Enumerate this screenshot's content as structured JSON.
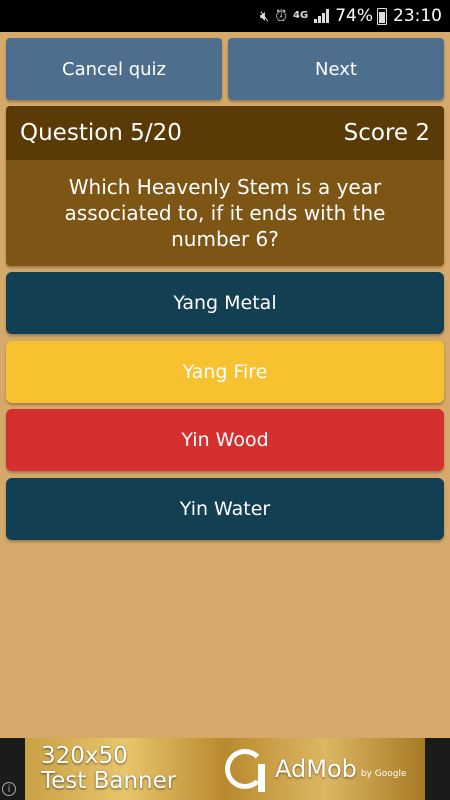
{
  "status_bar": {
    "battery_percent": "74%",
    "time": "23:10",
    "network": "4G"
  },
  "top_buttons": {
    "cancel_label": "Cancel quiz",
    "next_label": "Next"
  },
  "question": {
    "progress": "Question 5/20",
    "score": "Score 2",
    "text": "Which Heavenly Stem is a year associated to, if it ends with the number 6?"
  },
  "answers": [
    {
      "label": "Yang Metal",
      "state": "default",
      "color": "#123f52"
    },
    {
      "label": "Yang Fire",
      "state": "correct",
      "color": "#f7c130"
    },
    {
      "label": "Yin Wood",
      "state": "wrong",
      "color": "#d62f2f"
    },
    {
      "label": "Yin Water",
      "state": "default",
      "color": "#123f52"
    }
  ],
  "ad": {
    "size_text": "320x50",
    "label": "Test Banner",
    "brand": "AdMob",
    "by": "by Google",
    "info": "i"
  },
  "colors": {
    "background": "#d4a96a",
    "button": "#4e6e8e",
    "question_header": "#5a3a06",
    "question_body": "#7d5514"
  }
}
